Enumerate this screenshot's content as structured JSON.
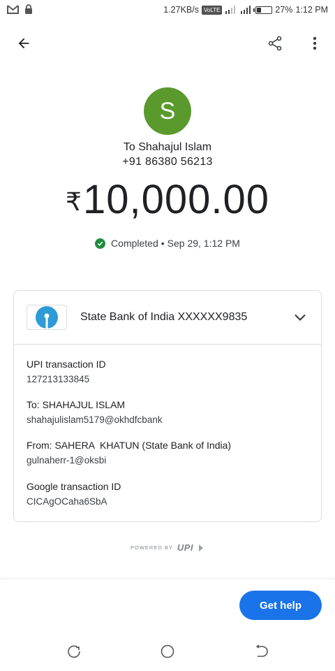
{
  "status_bar": {
    "speed": "1.27KB/s",
    "volte": "VoLTE",
    "battery": "27%",
    "battery_level": 0.27,
    "time": "1:12 PM"
  },
  "app_bar": {
    "back_icon": "arrow-back-icon",
    "share_icon": "share-icon",
    "more_icon": "more-vert-icon"
  },
  "recipient": {
    "avatar_letter": "S",
    "avatar_color": "#5a9a2c",
    "name_line": "To Shahajul Islam",
    "phone": "+91 86380 56213"
  },
  "payment": {
    "currency_symbol": "₹",
    "amount": "10,000.00",
    "status": "Completed",
    "separator": "•",
    "datetime": "Sep 29, 1:12 PM",
    "status_color": "#1e8e3e"
  },
  "account": {
    "bank_name": "State Bank of India XXXXXX9835",
    "logo_color": "#2d9bd6"
  },
  "details": [
    {
      "label": "UPI transaction ID",
      "value": "127213133845"
    },
    {
      "label": "To: SHAHAJUL ISLAM",
      "value": "shahajulislam5179@okhdfcbank"
    },
    {
      "label": "From: SAHERA  KHATUN (State Bank of India)",
      "value": "gulnaherr-1@oksbi"
    },
    {
      "label": "Google transaction ID",
      "value": "CICAgOCaha6SbA"
    }
  ],
  "footer": {
    "powered_by": "POWERED BY",
    "upi": "UPI"
  },
  "help_button": {
    "label": "Get help",
    "color": "#1a73e8"
  }
}
